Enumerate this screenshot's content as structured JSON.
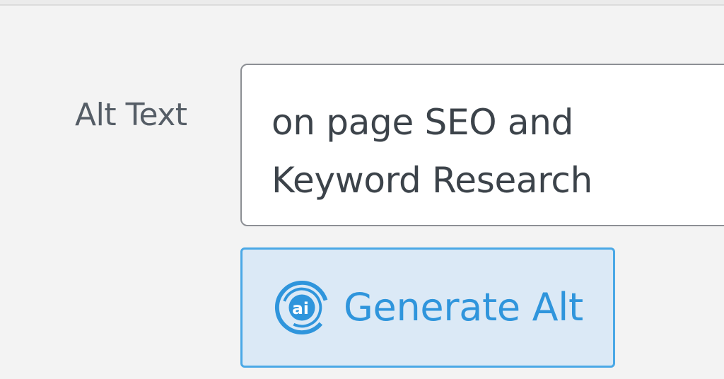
{
  "form": {
    "alt_label": "Alt Text",
    "alt_value_line1": "on page SEO and",
    "alt_value_line2": "Keyword Research"
  },
  "actions": {
    "generate_label": "Generate Alt",
    "generate_icon": "ai-icon"
  },
  "colors": {
    "background": "#f3f3f3",
    "label_text": "#555d66",
    "input_border": "#8c8f94",
    "button_bg": "#dbe9f6",
    "button_border": "#4aa8e6",
    "button_text": "#2f95dc"
  }
}
